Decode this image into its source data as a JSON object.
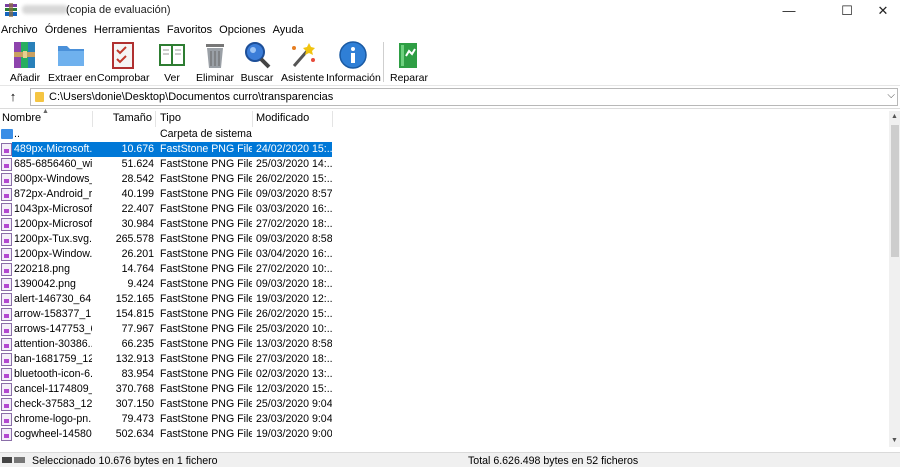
{
  "window": {
    "title_suffix": "(copia de evaluación)",
    "min_symbol": "—",
    "max_symbol": "☐",
    "close_symbol": "✕"
  },
  "menu": [
    {
      "label": "Archivo"
    },
    {
      "label": "Órdenes"
    },
    {
      "label": "Herramientas"
    },
    {
      "label": "Favoritos"
    },
    {
      "label": "Opciones"
    },
    {
      "label": "Ayuda"
    }
  ],
  "toolbar": {
    "add": "Añadir",
    "extract": "Extraer en",
    "test": "Comprobar",
    "view": "Ver",
    "delete": "Eliminar",
    "find": "Buscar",
    "wizard": "Asistente",
    "info": "Información",
    "repair": "Reparar"
  },
  "address": {
    "path": "C:\\Users\\donie\\Desktop\\Documentos curro\\transparencias"
  },
  "columns": {
    "name": "Nombre",
    "size": "Tamaño",
    "type": "Tipo",
    "modified": "Modificado"
  },
  "parent_row": {
    "name": "..",
    "type": "Carpeta de sistema"
  },
  "files": [
    {
      "name": "489px-Microsoft...",
      "size": "10.676",
      "type": "FastStone PNG File",
      "modified": "24/02/2020 15:..."
    },
    {
      "name": "685-6856460_wi...",
      "size": "51.624",
      "type": "FastStone PNG File",
      "modified": "25/03/2020 14:..."
    },
    {
      "name": "800px-Windows_...",
      "size": "28.542",
      "type": "FastStone PNG File",
      "modified": "26/02/2020 15:..."
    },
    {
      "name": "872px-Android_r...",
      "size": "40.199",
      "type": "FastStone PNG File",
      "modified": "09/03/2020 8:57"
    },
    {
      "name": "1043px-Microsof...",
      "size": "22.407",
      "type": "FastStone PNG File",
      "modified": "03/03/2020 16:..."
    },
    {
      "name": "1200px-Microsof...",
      "size": "30.984",
      "type": "FastStone PNG File",
      "modified": "27/02/2020 18:..."
    },
    {
      "name": "1200px-Tux.svg....",
      "size": "265.578",
      "type": "FastStone PNG File",
      "modified": "09/03/2020 8:58"
    },
    {
      "name": "1200px-Window...",
      "size": "26.201",
      "type": "FastStone PNG File",
      "modified": "03/04/2020 16:..."
    },
    {
      "name": "220218.png",
      "size": "14.764",
      "type": "FastStone PNG File",
      "modified": "27/02/2020 10:..."
    },
    {
      "name": "1390042.png",
      "size": "9.424",
      "type": "FastStone PNG File",
      "modified": "09/03/2020 18:..."
    },
    {
      "name": "alert-146730_64...",
      "size": "152.165",
      "type": "FastStone PNG File",
      "modified": "19/03/2020 12:..."
    },
    {
      "name": "arrow-158377_1...",
      "size": "154.815",
      "type": "FastStone PNG File",
      "modified": "26/02/2020 15:..."
    },
    {
      "name": "arrows-147753_6...",
      "size": "77.967",
      "type": "FastStone PNG File",
      "modified": "25/03/2020 10:..."
    },
    {
      "name": "attention-30386...",
      "size": "66.235",
      "type": "FastStone PNG File",
      "modified": "13/03/2020 8:58"
    },
    {
      "name": "ban-1681759_12...",
      "size": "132.913",
      "type": "FastStone PNG File",
      "modified": "27/03/2020 18:..."
    },
    {
      "name": "bluetooth-icon-6...",
      "size": "83.954",
      "type": "FastStone PNG File",
      "modified": "02/03/2020 13:..."
    },
    {
      "name": "cancel-1174809_...",
      "size": "370.768",
      "type": "FastStone PNG File",
      "modified": "12/03/2020 15:..."
    },
    {
      "name": "check-37583_128...",
      "size": "307.150",
      "type": "FastStone PNG File",
      "modified": "25/03/2020 9:04"
    },
    {
      "name": "chrome-logo-pn...",
      "size": "79.473",
      "type": "FastStone PNG File",
      "modified": "23/03/2020 9:04"
    },
    {
      "name": "cogwheel-14580...",
      "size": "502.634",
      "type": "FastStone PNG File",
      "modified": "19/03/2020 9:00"
    }
  ],
  "selected_index": 0,
  "status": {
    "left": "Seleccionado 10.676 bytes en 1 fichero",
    "right": "Total 6.626.498 bytes en 52 ficheros"
  },
  "colors": {
    "selection": "#0078d7"
  }
}
